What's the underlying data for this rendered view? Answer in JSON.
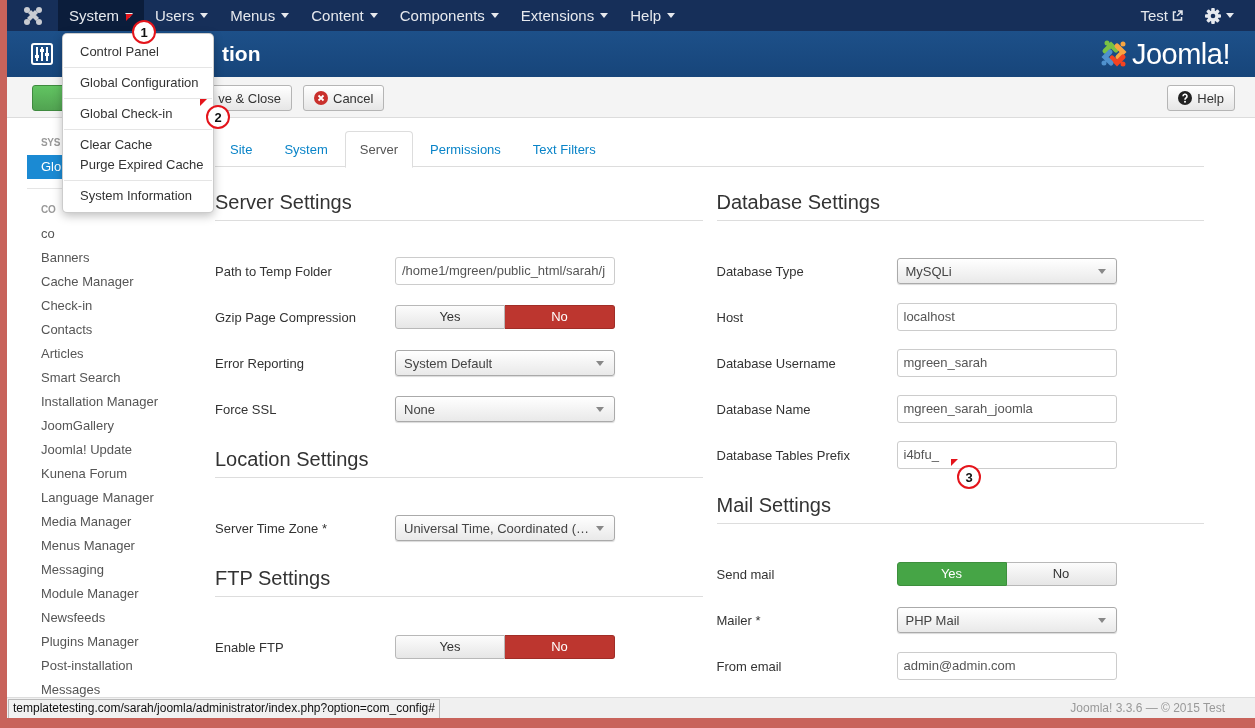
{
  "navbar": {
    "items": [
      {
        "label": "System",
        "selected": true,
        "menu": {
          "groups": [
            {
              "items": [
                {
                  "label": "Control Panel"
                }
              ]
            },
            {
              "items": [
                {
                  "label": "Global Configuration"
                }
              ]
            },
            {
              "items": [
                {
                  "label": "Global Check-in"
                }
              ]
            },
            {
              "items": [
                {
                  "label": "Clear Cache"
                },
                {
                  "label": "Purge Expired Cache"
                }
              ]
            },
            {
              "items": [
                {
                  "label": "System Information"
                }
              ]
            }
          ]
        }
      },
      {
        "label": "Users",
        "selected": false
      },
      {
        "label": "Menus",
        "selected": false
      },
      {
        "label": "Content",
        "selected": false
      },
      {
        "label": "Components",
        "selected": false
      },
      {
        "label": "Extensions",
        "selected": false
      },
      {
        "label": "Help",
        "selected": false
      }
    ],
    "user": "Test"
  },
  "header": {
    "title": "tion",
    "logo_text": "Joomla!"
  },
  "toolbar": {
    "buttons": [
      {
        "kind": "save"
      },
      {
        "kind": "save-close",
        "label": "ve & Close"
      },
      {
        "kind": "cancel",
        "label": "Cancel"
      }
    ],
    "help": "Help"
  },
  "sidebar": {
    "sections": [
      {
        "heading": "SYS",
        "items": [
          {
            "label": "Glo",
            "selected": true
          }
        ]
      },
      {
        "heading": "CO",
        "items": [
          {
            "label": "co",
            "selected": false
          },
          {
            "label": "Banners",
            "selected": false
          },
          {
            "label": "Cache Manager",
            "selected": false
          },
          {
            "label": "Check-in",
            "selected": false
          },
          {
            "label": "Contacts",
            "selected": false
          },
          {
            "label": "Articles",
            "selected": false
          },
          {
            "label": "Smart Search",
            "selected": false
          },
          {
            "label": "Installation Manager",
            "selected": false
          },
          {
            "label": "JoomGallery",
            "selected": false
          },
          {
            "label": "Joomla! Update",
            "selected": false
          },
          {
            "label": "Kunena Forum",
            "selected": false
          },
          {
            "label": "Language Manager",
            "selected": false
          },
          {
            "label": "Media Manager",
            "selected": false
          },
          {
            "label": "Menus Manager",
            "selected": false
          },
          {
            "label": "Messaging",
            "selected": false
          },
          {
            "label": "Module Manager",
            "selected": false
          },
          {
            "label": "Newsfeeds",
            "selected": false
          },
          {
            "label": "Plugins Manager",
            "selected": false
          },
          {
            "label": "Post-installation Messages",
            "selected": false
          }
        ]
      }
    ]
  },
  "tabs": [
    {
      "label": "Site",
      "selected": false
    },
    {
      "label": "System",
      "selected": false
    },
    {
      "label": "Server",
      "selected": true
    },
    {
      "label": "Permissions",
      "selected": false
    },
    {
      "label": "Text Filters",
      "selected": false
    }
  ],
  "columns": [
    {
      "sections": [
        {
          "heading": "Server Settings",
          "fields": [
            {
              "label": "Path to Temp Folder",
              "kind": "text",
              "value": "/home1/mgreen/public_html/sarah/j"
            },
            {
              "label": "Gzip Page Compression",
              "kind": "toggle",
              "options": [
                {
                  "label": "Yes",
                  "selected": false
                },
                {
                  "label": "No",
                  "selected": true
                }
              ]
            },
            {
              "label": "Error Reporting",
              "kind": "select",
              "value": "System Default"
            },
            {
              "label": "Force SSL",
              "kind": "select",
              "value": "None"
            }
          ]
        },
        {
          "heading": "Location Settings",
          "fields": [
            {
              "label": "Server Time Zone *",
              "kind": "select",
              "value": "Universal Time, Coordinated (…"
            }
          ]
        },
        {
          "heading": "FTP Settings",
          "fields": [
            {
              "label": "Enable FTP",
              "kind": "toggle",
              "options": [
                {
                  "label": "Yes",
                  "selected": false
                },
                {
                  "label": "No",
                  "selected": true
                }
              ]
            }
          ]
        }
      ]
    },
    {
      "sections": [
        {
          "heading": "Database Settings",
          "fields": [
            {
              "label": "Database Type",
              "kind": "select",
              "value": "MySQLi"
            },
            {
              "label": "Host",
              "kind": "text",
              "value": "localhost"
            },
            {
              "label": "Database Username",
              "kind": "text",
              "value": "mgreen_sarah"
            },
            {
              "label": "Database Name",
              "kind": "text",
              "value": "mgreen_sarah_joomla"
            },
            {
              "label": "Database Tables Prefix",
              "kind": "text",
              "value": "i4bfu_"
            }
          ]
        },
        {
          "heading": "Mail Settings",
          "fields": [
            {
              "label": "Send mail",
              "kind": "toggle",
              "options": [
                {
                  "label": "Yes",
                  "selected": true
                },
                {
                  "label": "No",
                  "selected": false
                }
              ]
            },
            {
              "label": "Mailer *",
              "kind": "select",
              "value": "PHP Mail"
            },
            {
              "label": "From email",
              "kind": "text",
              "value": "admin@admin.com"
            }
          ]
        }
      ]
    }
  ],
  "footer": "Joomla! 3.3.6 — © 2015 Test",
  "status_url": "templatetesting.com/sarah/joomla/administrator/index.php?option=com_config#",
  "annotations": [
    {
      "label": "1"
    },
    {
      "label": "2"
    },
    {
      "label": "3"
    }
  ]
}
